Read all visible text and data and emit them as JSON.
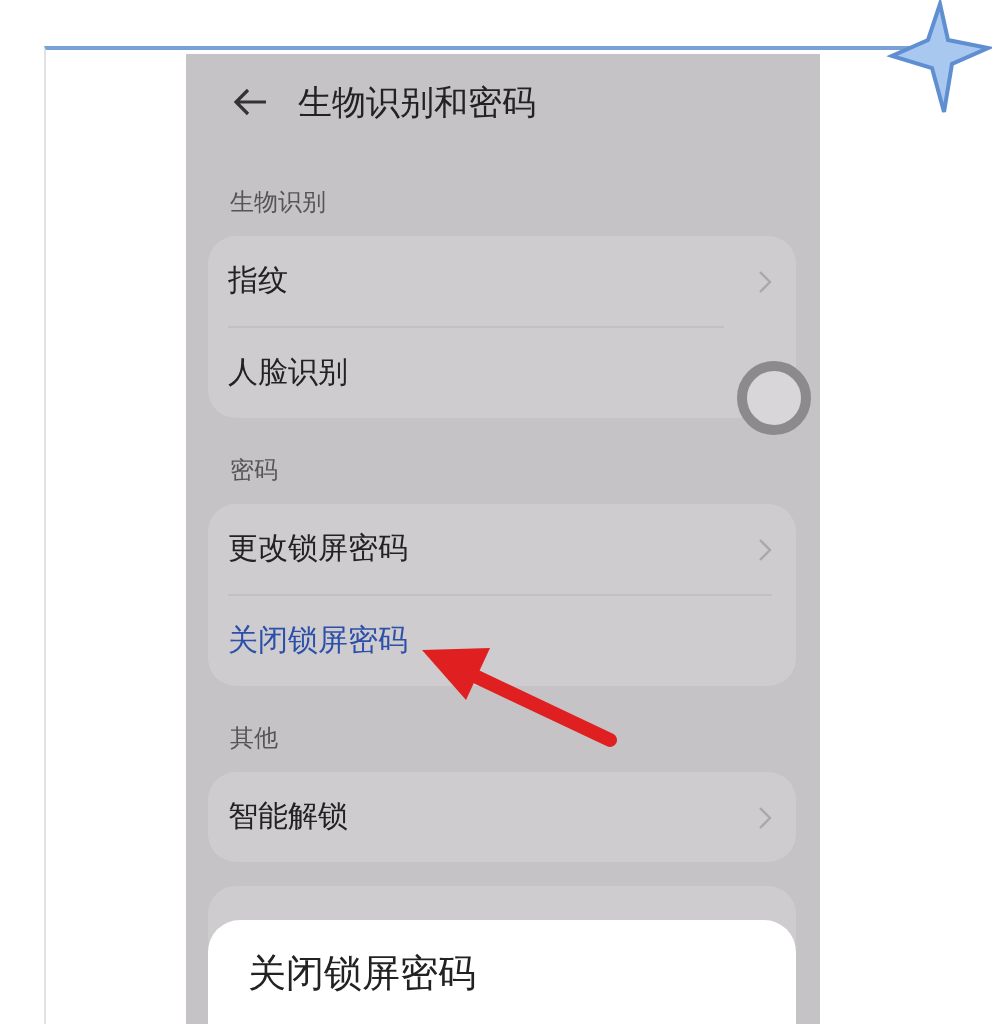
{
  "header": {
    "title": "生物识别和密码"
  },
  "sections": [
    {
      "heading": "生物识别",
      "items": [
        {
          "label": "指纹",
          "kind": "chevron"
        },
        {
          "label": "人脸识别",
          "kind": "plain"
        }
      ]
    },
    {
      "heading": "密码",
      "items": [
        {
          "label": "更改锁屏密码",
          "kind": "chevron"
        },
        {
          "label": "关闭锁屏密码",
          "kind": "action"
        }
      ]
    },
    {
      "heading": "其他",
      "items": [
        {
          "label": "智能解锁",
          "kind": "chevron"
        }
      ]
    }
  ],
  "dialog": {
    "title": "关闭锁屏密码"
  }
}
